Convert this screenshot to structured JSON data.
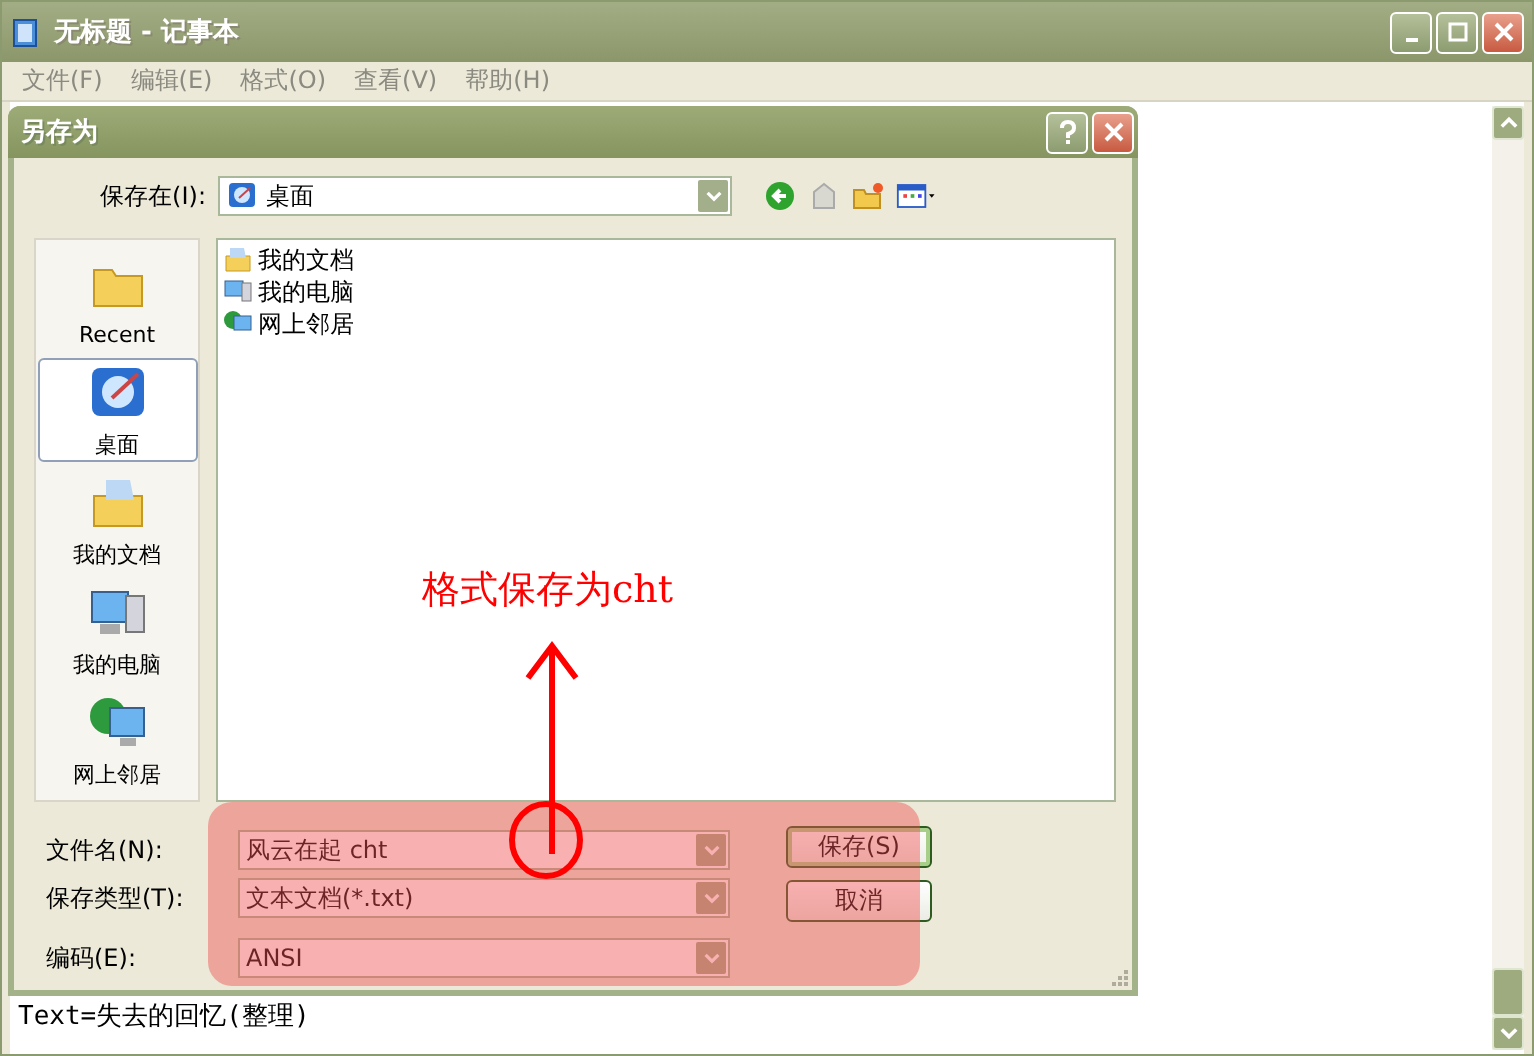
{
  "window": {
    "title": "无标题 - 记事本"
  },
  "menu": [
    "文件(F)",
    "编辑(E)",
    "格式(O)",
    "查看(V)",
    "帮助(H)"
  ],
  "editor": {
    "text": "Text=失去的回忆(整理)"
  },
  "dialog": {
    "title": "另存为",
    "save_in": {
      "label": "保存在(I):",
      "value": "桌面"
    },
    "places": [
      {
        "label": "Recent",
        "kind": "recent",
        "selected": false
      },
      {
        "label": "桌面",
        "kind": "desktop",
        "selected": true
      },
      {
        "label": "我的文档",
        "kind": "documents",
        "selected": false
      },
      {
        "label": "我的电脑",
        "kind": "computer",
        "selected": false
      },
      {
        "label": "网上邻居",
        "kind": "network",
        "selected": false
      }
    ],
    "files": [
      {
        "name": "我的文档",
        "kind": "documents"
      },
      {
        "name": "我的电脑",
        "kind": "computer"
      },
      {
        "name": "网上邻居",
        "kind": "network"
      }
    ],
    "fields": [
      {
        "label": "文件名(N):",
        "value": "风云在起 cht"
      },
      {
        "label": "保存类型(T):",
        "value": "文本文档(*.txt)"
      },
      {
        "label": "编码(E):",
        "value": "ANSI"
      }
    ],
    "buttons": [
      {
        "label": "保存(S)",
        "default": true
      },
      {
        "label": "取消",
        "default": false
      }
    ]
  },
  "annotation": {
    "text": "格式保存为cht"
  }
}
